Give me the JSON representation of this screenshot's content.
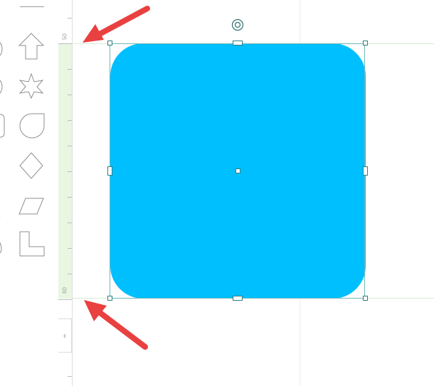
{
  "ruler": {
    "label_top": "50",
    "label_bottom": "60"
  },
  "sidebar": {
    "collapse_glyph": "‹"
  },
  "colors": {
    "shape_fill": "#00bfff",
    "selection": "#2f7f7f",
    "arrow": "#e94040",
    "ruler_highlight": "#e8f6e2"
  },
  "icons": [
    "circle-shape-icon",
    "arrow-up-shape-icon",
    "star-shape-icon",
    "teardrop-shape-icon",
    "diamond-shape-icon",
    "parallelogram-shape-icon",
    "l-shape-icon",
    "rotate-handle-icon",
    "chevron-left-icon"
  ]
}
